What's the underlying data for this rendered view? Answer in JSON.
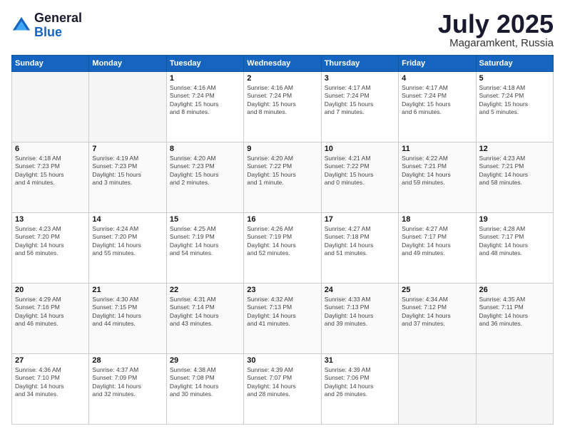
{
  "header": {
    "logo_general": "General",
    "logo_blue": "Blue",
    "month": "July 2025",
    "location": "Magaramkent, Russia"
  },
  "weekdays": [
    "Sunday",
    "Monday",
    "Tuesday",
    "Wednesday",
    "Thursday",
    "Friday",
    "Saturday"
  ],
  "weeks": [
    [
      {
        "day": "",
        "info": ""
      },
      {
        "day": "",
        "info": ""
      },
      {
        "day": "1",
        "info": "Sunrise: 4:16 AM\nSunset: 7:24 PM\nDaylight: 15 hours\nand 8 minutes."
      },
      {
        "day": "2",
        "info": "Sunrise: 4:16 AM\nSunset: 7:24 PM\nDaylight: 15 hours\nand 8 minutes."
      },
      {
        "day": "3",
        "info": "Sunrise: 4:17 AM\nSunset: 7:24 PM\nDaylight: 15 hours\nand 7 minutes."
      },
      {
        "day": "4",
        "info": "Sunrise: 4:17 AM\nSunset: 7:24 PM\nDaylight: 15 hours\nand 6 minutes."
      },
      {
        "day": "5",
        "info": "Sunrise: 4:18 AM\nSunset: 7:24 PM\nDaylight: 15 hours\nand 5 minutes."
      }
    ],
    [
      {
        "day": "6",
        "info": "Sunrise: 4:18 AM\nSunset: 7:23 PM\nDaylight: 15 hours\nand 4 minutes."
      },
      {
        "day": "7",
        "info": "Sunrise: 4:19 AM\nSunset: 7:23 PM\nDaylight: 15 hours\nand 3 minutes."
      },
      {
        "day": "8",
        "info": "Sunrise: 4:20 AM\nSunset: 7:23 PM\nDaylight: 15 hours\nand 2 minutes."
      },
      {
        "day": "9",
        "info": "Sunrise: 4:20 AM\nSunset: 7:22 PM\nDaylight: 15 hours\nand 1 minute."
      },
      {
        "day": "10",
        "info": "Sunrise: 4:21 AM\nSunset: 7:22 PM\nDaylight: 15 hours\nand 0 minutes."
      },
      {
        "day": "11",
        "info": "Sunrise: 4:22 AM\nSunset: 7:21 PM\nDaylight: 14 hours\nand 59 minutes."
      },
      {
        "day": "12",
        "info": "Sunrise: 4:23 AM\nSunset: 7:21 PM\nDaylight: 14 hours\nand 58 minutes."
      }
    ],
    [
      {
        "day": "13",
        "info": "Sunrise: 4:23 AM\nSunset: 7:20 PM\nDaylight: 14 hours\nand 56 minutes."
      },
      {
        "day": "14",
        "info": "Sunrise: 4:24 AM\nSunset: 7:20 PM\nDaylight: 14 hours\nand 55 minutes."
      },
      {
        "day": "15",
        "info": "Sunrise: 4:25 AM\nSunset: 7:19 PM\nDaylight: 14 hours\nand 54 minutes."
      },
      {
        "day": "16",
        "info": "Sunrise: 4:26 AM\nSunset: 7:19 PM\nDaylight: 14 hours\nand 52 minutes."
      },
      {
        "day": "17",
        "info": "Sunrise: 4:27 AM\nSunset: 7:18 PM\nDaylight: 14 hours\nand 51 minutes."
      },
      {
        "day": "18",
        "info": "Sunrise: 4:27 AM\nSunset: 7:17 PM\nDaylight: 14 hours\nand 49 minutes."
      },
      {
        "day": "19",
        "info": "Sunrise: 4:28 AM\nSunset: 7:17 PM\nDaylight: 14 hours\nand 48 minutes."
      }
    ],
    [
      {
        "day": "20",
        "info": "Sunrise: 4:29 AM\nSunset: 7:16 PM\nDaylight: 14 hours\nand 46 minutes."
      },
      {
        "day": "21",
        "info": "Sunrise: 4:30 AM\nSunset: 7:15 PM\nDaylight: 14 hours\nand 44 minutes."
      },
      {
        "day": "22",
        "info": "Sunrise: 4:31 AM\nSunset: 7:14 PM\nDaylight: 14 hours\nand 43 minutes."
      },
      {
        "day": "23",
        "info": "Sunrise: 4:32 AM\nSunset: 7:13 PM\nDaylight: 14 hours\nand 41 minutes."
      },
      {
        "day": "24",
        "info": "Sunrise: 4:33 AM\nSunset: 7:13 PM\nDaylight: 14 hours\nand 39 minutes."
      },
      {
        "day": "25",
        "info": "Sunrise: 4:34 AM\nSunset: 7:12 PM\nDaylight: 14 hours\nand 37 minutes."
      },
      {
        "day": "26",
        "info": "Sunrise: 4:35 AM\nSunset: 7:11 PM\nDaylight: 14 hours\nand 36 minutes."
      }
    ],
    [
      {
        "day": "27",
        "info": "Sunrise: 4:36 AM\nSunset: 7:10 PM\nDaylight: 14 hours\nand 34 minutes."
      },
      {
        "day": "28",
        "info": "Sunrise: 4:37 AM\nSunset: 7:09 PM\nDaylight: 14 hours\nand 32 minutes."
      },
      {
        "day": "29",
        "info": "Sunrise: 4:38 AM\nSunset: 7:08 PM\nDaylight: 14 hours\nand 30 minutes."
      },
      {
        "day": "30",
        "info": "Sunrise: 4:39 AM\nSunset: 7:07 PM\nDaylight: 14 hours\nand 28 minutes."
      },
      {
        "day": "31",
        "info": "Sunrise: 4:39 AM\nSunset: 7:06 PM\nDaylight: 14 hours\nand 26 minutes."
      },
      {
        "day": "",
        "info": ""
      },
      {
        "day": "",
        "info": ""
      }
    ]
  ]
}
